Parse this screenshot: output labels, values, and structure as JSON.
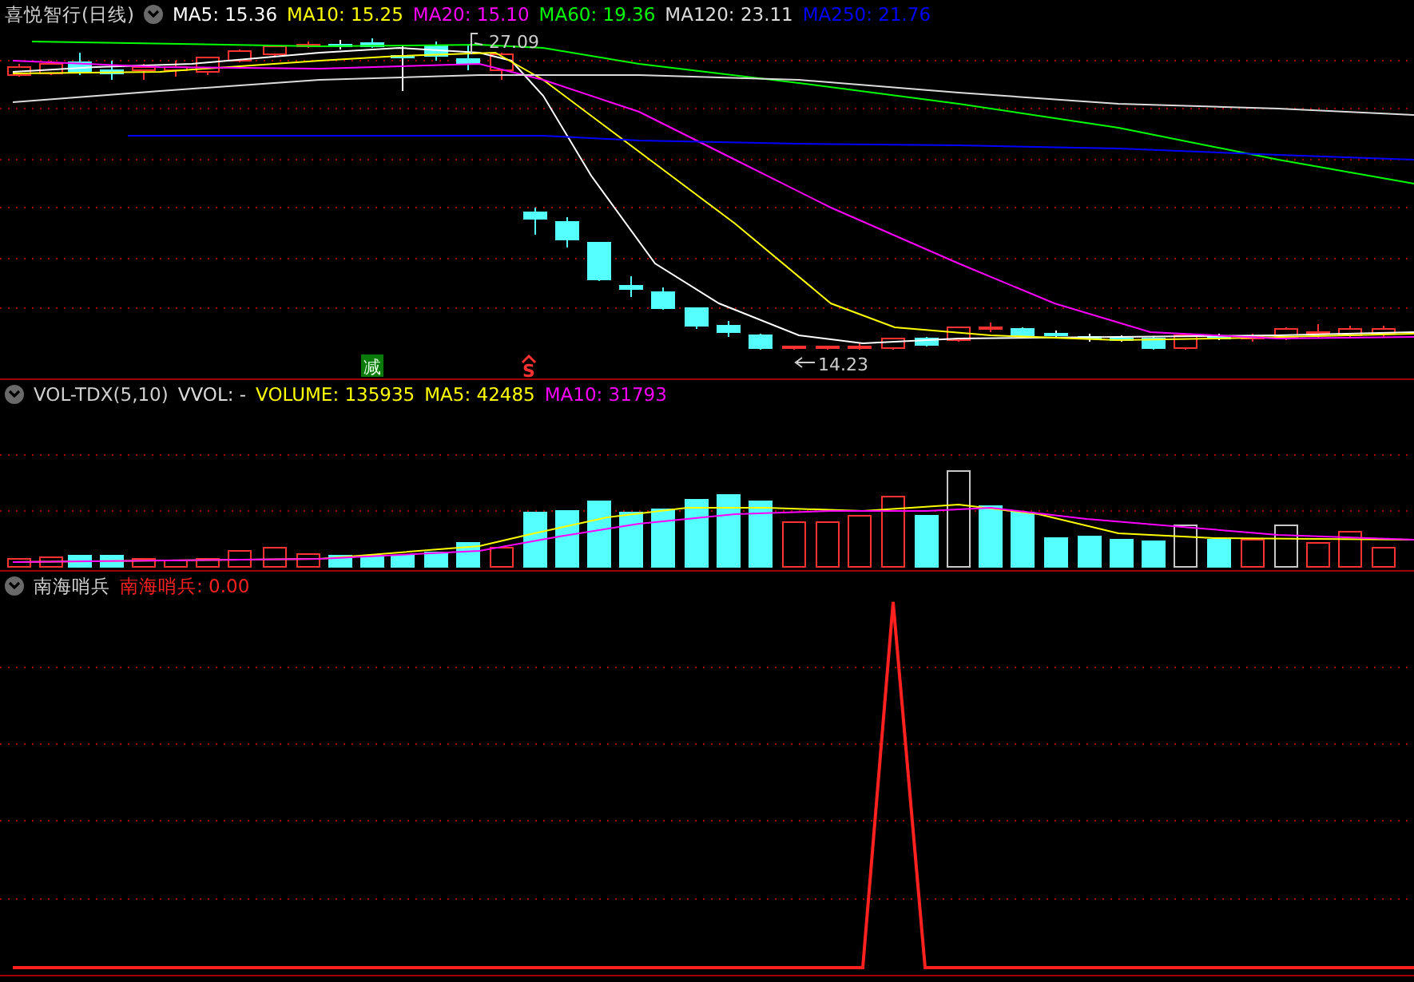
{
  "price_pane": {
    "title": "喜悦智行(日线)",
    "legend": [
      {
        "label": "MA5: 15.36",
        "color": "#ffffff"
      },
      {
        "label": "MA10: 15.25",
        "color": "#ffff00"
      },
      {
        "label": "MA20: 15.10",
        "color": "#ff00ff"
      },
      {
        "label": "MA60: 19.36",
        "color": "#00ff00"
      },
      {
        "label": "MA120: 23.11",
        "color": "#dcdcdc"
      },
      {
        "label": "MA250: 21.76",
        "color": "#0000ff"
      }
    ],
    "high_label": "27.09",
    "low_label": "14.23",
    "signals": [
      {
        "kind": "reduce",
        "text": "减"
      },
      {
        "kind": "sell",
        "text": "S"
      }
    ]
  },
  "volume_pane": {
    "title": "VOL-TDX(5,10)",
    "legend": [
      {
        "label": "VVOL: -",
        "color": "#dcdcdc"
      },
      {
        "label": "VOLUME: 135935",
        "color": "#ffff00"
      },
      {
        "label": "MA5: 42485",
        "color": "#ffff00"
      },
      {
        "label": "MA10: 31793",
        "color": "#ff00ff"
      }
    ]
  },
  "indicator_pane": {
    "title": "南海哨兵",
    "legend": [
      {
        "label": "南海哨兵: 0.00",
        "color": "#ff2020"
      }
    ]
  }
}
